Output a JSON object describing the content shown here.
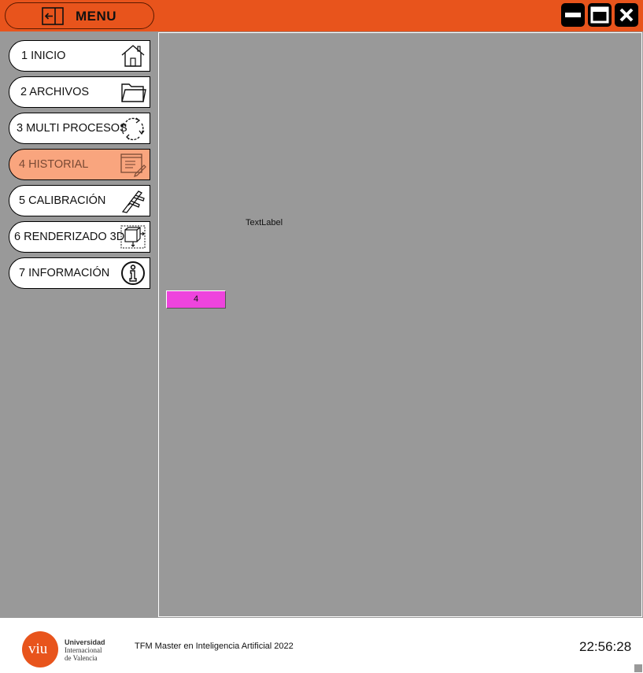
{
  "topbar": {
    "menu_label": "MENU",
    "menu_icon": "exit-arrow-icon",
    "window_controls": [
      "minimize-icon",
      "maximize-icon",
      "close-icon"
    ],
    "accent_color": "#e8541c"
  },
  "sidebar": {
    "items": [
      {
        "label": "1 INICIO",
        "icon": "home-icon",
        "active": false
      },
      {
        "label": "2 ARCHIVOS",
        "icon": "folder-icon",
        "active": false
      },
      {
        "label": "3 MULTI PROCESOS",
        "icon": "cycle-arrows-icon",
        "active": false
      },
      {
        "label": "4 HISTORIAL",
        "icon": "document-edit-icon",
        "active": true
      },
      {
        "label": "5 CALIBRACIÓN",
        "icon": "caliper-icon",
        "active": false
      },
      {
        "label": "6 RENDERIZADO 3D",
        "icon": "render-cube-icon",
        "active": false
      },
      {
        "label": "7 INFORMACIÓN",
        "icon": "info-icon",
        "active": false
      }
    ],
    "active_color": "#f9a57e"
  },
  "content": {
    "text_label": "TextLabel",
    "pink_button_label": "4",
    "pink_button_color": "#ee44dd"
  },
  "footer": {
    "logo_mark": "viu",
    "logo_lines": [
      "Universidad",
      "Internacional",
      "de Valencia"
    ],
    "caption": "TFM Master en Inteligencia Artificial 2022",
    "clock": "22:56:28"
  }
}
